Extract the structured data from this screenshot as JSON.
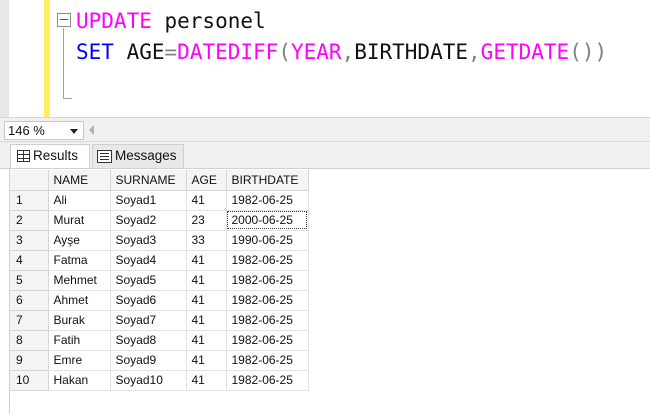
{
  "editor": {
    "line1": {
      "keyword": "UPDATE",
      "table": " personel"
    },
    "line2": {
      "set": "SET",
      "col": " AGE",
      "eq": "=",
      "fn": "DATEDIFF",
      "open": "(",
      "arg1": "YEAR",
      "comma1": ",",
      "arg2": "BIRTHDATE",
      "comma2": ",",
      "fn2": "GETDATE",
      "parens": "()",
      "close": ")"
    }
  },
  "zoom": {
    "value": "146 %"
  },
  "tabs": [
    {
      "label": "Results",
      "icon": "grid-icon",
      "active": true
    },
    {
      "label": "Messages",
      "icon": "messages-icon",
      "active": false
    }
  ],
  "grid": {
    "columns": [
      "",
      "NAME",
      "SURNAME",
      "AGE",
      "BIRTHDATE"
    ],
    "rows": [
      [
        "1",
        "Ali",
        "Soyad1",
        "41",
        "1982-06-25"
      ],
      [
        "2",
        "Murat",
        "Soyad2",
        "23",
        "2000-06-25"
      ],
      [
        "3",
        "Ayşe",
        "Soyad3",
        "33",
        "1990-06-25"
      ],
      [
        "4",
        "Fatma",
        "Soyad4",
        "41",
        "1982-06-25"
      ],
      [
        "5",
        "Mehmet",
        "Soyad5",
        "41",
        "1982-06-25"
      ],
      [
        "6",
        "Ahmet",
        "Soyad6",
        "41",
        "1982-06-25"
      ],
      [
        "7",
        "Burak",
        "Soyad7",
        "41",
        "1982-06-25"
      ],
      [
        "8",
        "Fatih",
        "Soyad8",
        "41",
        "1982-06-25"
      ],
      [
        "9",
        "Emre",
        "Soyad9",
        "41",
        "1982-06-25"
      ],
      [
        "10",
        "Hakan",
        "Soyad10",
        "41",
        "1982-06-25"
      ]
    ]
  }
}
